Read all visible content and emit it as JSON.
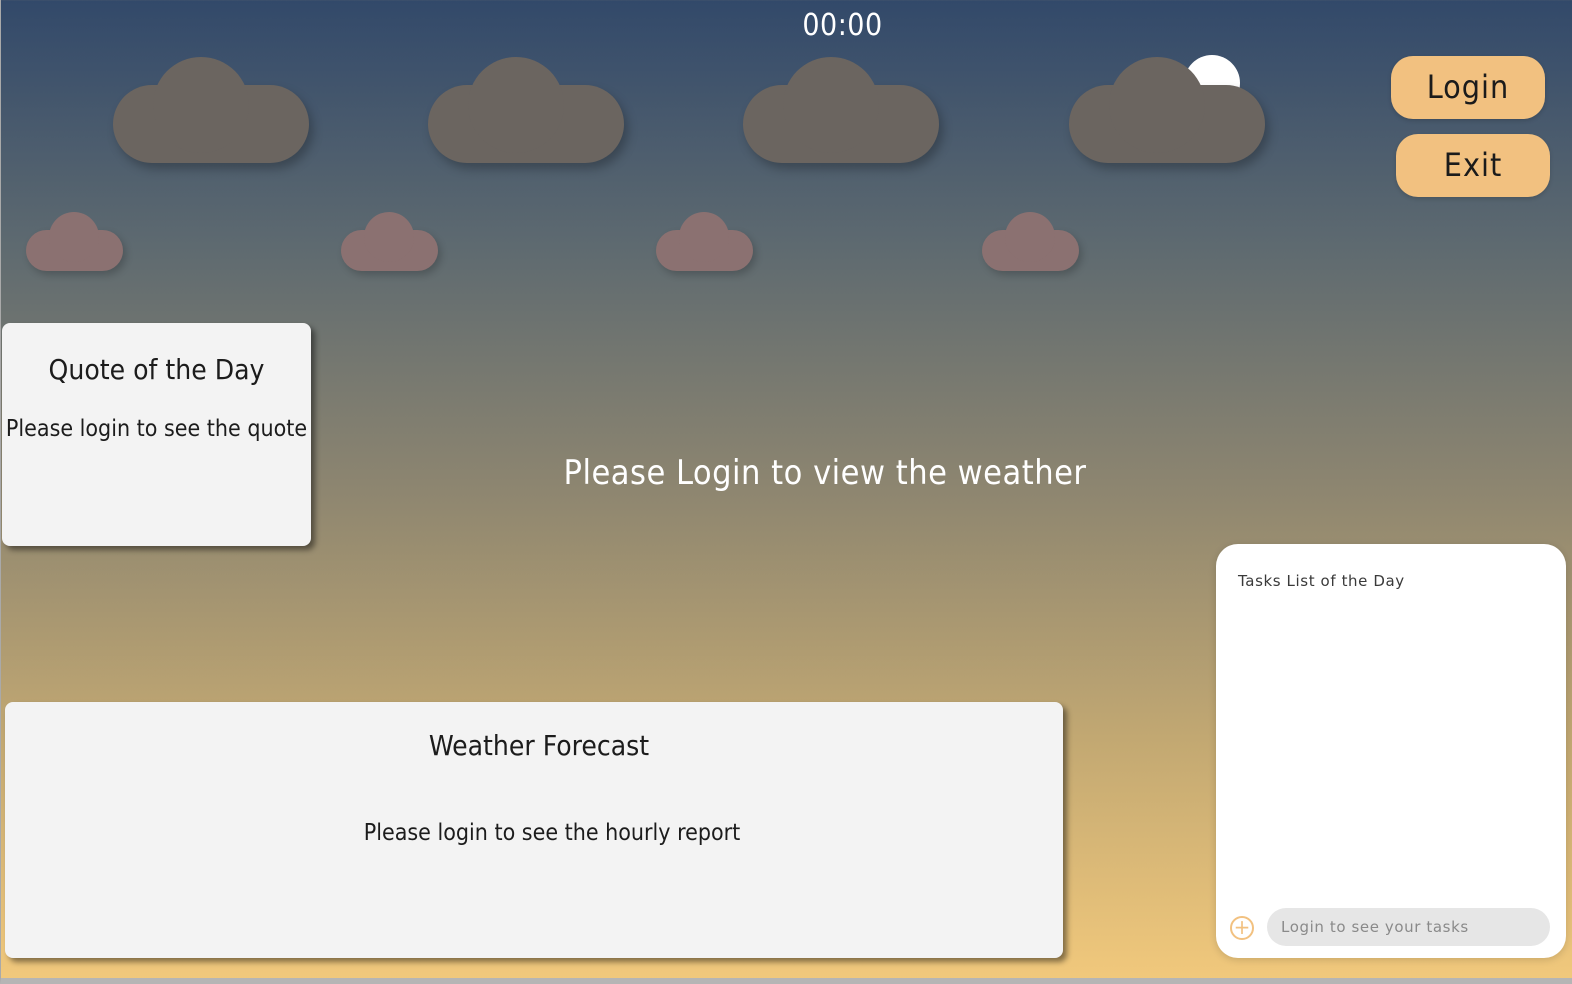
{
  "clock": {
    "time": "00:00"
  },
  "header": {
    "login_label": "Login",
    "exit_label": "Exit"
  },
  "quote": {
    "title": "Quote of the Day",
    "message": "Please login to see the quote"
  },
  "weather": {
    "message": "Please Login to view the weather"
  },
  "forecast": {
    "title": "Weather Forecast",
    "message": "Please login to see the hourly report"
  },
  "tasks": {
    "title": "Tasks List of the Day",
    "add_icon": "plus-circle-icon",
    "input_placeholder": "Login to see your tasks",
    "input_value": ""
  },
  "colors": {
    "sky_top": "#32496a",
    "sky_bottom": "#f2c97c",
    "accent": "#f2c180",
    "cloud_dark": "#6b6560",
    "cloud_pink": "#8b7171",
    "card_bg": "#f3f3f3"
  }
}
